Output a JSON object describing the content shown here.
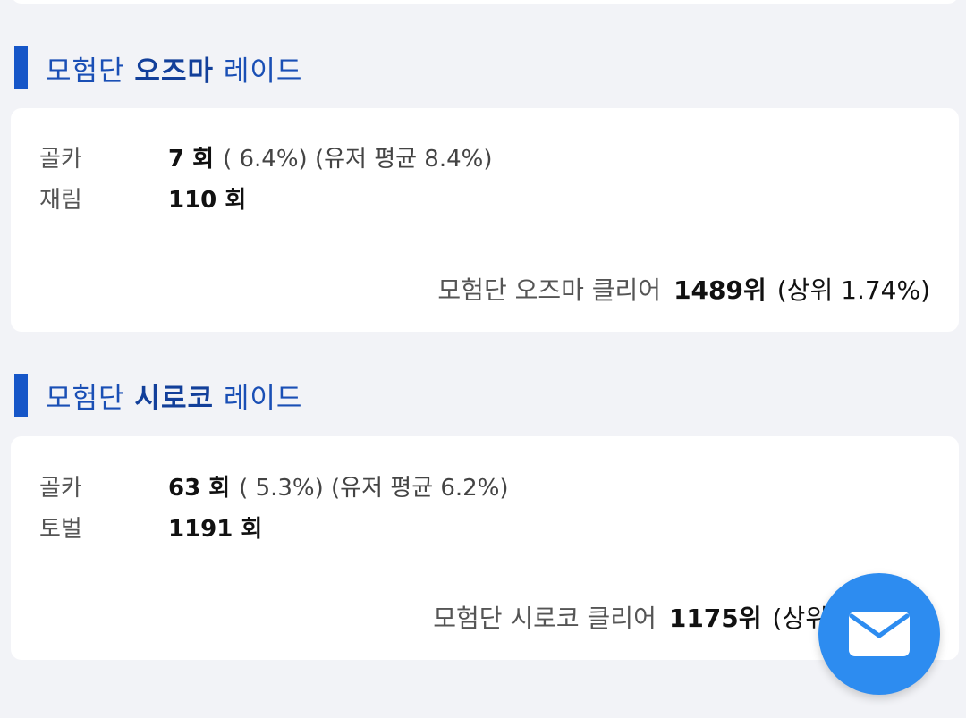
{
  "sections": [
    {
      "title_prefix": "모험단 ",
      "title_bold": "오즈마",
      "title_suffix": " 레이드",
      "rows": [
        {
          "label": "골카",
          "value": "7 회",
          "extra": "( 6.4%) (유저 평균 8.4%)"
        },
        {
          "label": "재림",
          "value": "110 회",
          "extra": ""
        }
      ],
      "rank_label": "모험단 오즈마 클리어",
      "rank_value": "1489위",
      "rank_pct": "(상위 1.74%)"
    },
    {
      "title_prefix": "모험단 ",
      "title_bold": "시로코",
      "title_suffix": " 레이드",
      "rows": [
        {
          "label": "골카",
          "value": "63 회",
          "extra": "( 5.3%) (유저 평균 6.2%)"
        },
        {
          "label": "토벌",
          "value": "1191 회",
          "extra": ""
        }
      ],
      "rank_label": "모험단 시로코 클리어",
      "rank_value": "1175위",
      "rank_pct": "(상위"
    }
  ],
  "fab": {
    "icon": "mail-icon",
    "color": "#2d8cf0"
  }
}
